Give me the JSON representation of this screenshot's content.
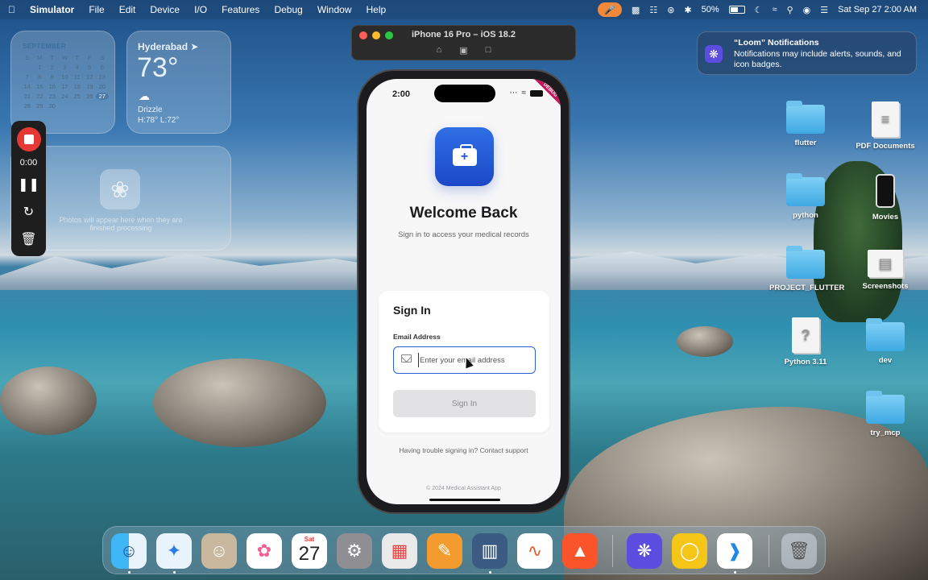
{
  "menubar": {
    "app_name": "Simulator",
    "items": [
      "File",
      "Edit",
      "Device",
      "I/O",
      "Features",
      "Debug",
      "Window",
      "Help"
    ],
    "battery": "50%",
    "datetime": "Sat Sep 27  2:00 AM"
  },
  "calendar_widget": {
    "month": "SEPTEMBER",
    "weekdays": [
      "S",
      "M",
      "T",
      "W",
      "T",
      "F",
      "S"
    ],
    "days": [
      "",
      "1",
      "2",
      "3",
      "4",
      "5",
      "6",
      "7",
      "8",
      "9",
      "10",
      "11",
      "12",
      "13",
      "14",
      "15",
      "16",
      "17",
      "18",
      "19",
      "20",
      "21",
      "22",
      "23",
      "24",
      "25",
      "26",
      "27",
      "28",
      "29",
      "30"
    ],
    "today": "27"
  },
  "weather_widget": {
    "city": "Hyderabad",
    "temp": "73°",
    "condition": "Drizzle",
    "high_low": "H:78° L:72°"
  },
  "photos_widget": {
    "message": "Photos will appear here when they are finished processing"
  },
  "loom_control": {
    "time": "0:00"
  },
  "simulator": {
    "title": "iPhone 16 Pro – iOS 18.2"
  },
  "phone": {
    "status_time": "2:00",
    "debug_banner": "DEBUG",
    "welcome": "Welcome Back",
    "subtitle": "Sign in to access your medical records",
    "card_title": "Sign In",
    "email_label": "Email Address",
    "email_placeholder": "Enter your email address",
    "email_value": "",
    "signin_button": "Sign In",
    "trouble_text": "Having trouble signing in? Contact support",
    "copyright": "© 2024 Medical Assistant App"
  },
  "notification": {
    "title": "“Loom” Notifications",
    "body": "Notifications may include alerts, sounds, and icon badges."
  },
  "desktop_icons": [
    {
      "label": "flutter"
    },
    {
      "label": "PDF Documents"
    },
    {
      "label": "python"
    },
    {
      "label": "Movies"
    },
    {
      "label": "PROJECT_FLUTTER"
    },
    {
      "label": "Screenshots"
    },
    {
      "label": "Python 3.11"
    },
    {
      "label": "dev"
    },
    {
      "label": "try_mcp"
    }
  ],
  "dock": {
    "calendar_month": "Sat",
    "calendar_day": "27"
  },
  "colors": {
    "accent": "#2d5fd4",
    "app_icon": "#2456d3",
    "record": "#e53935"
  }
}
